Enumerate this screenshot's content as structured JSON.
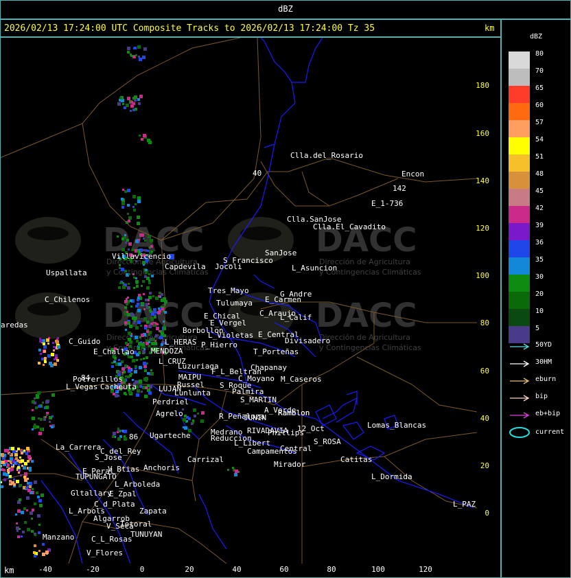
{
  "app": {
    "title": "dBZ"
  },
  "header": {
    "text": "2026/02/13 17:24:00 UTC Composite Tracks to 2026/02/13 17:24:00 Tz 35",
    "unit": "km"
  },
  "axes": {
    "bottom_unit": "km",
    "x_ticks": [
      "-40",
      "-20",
      "0",
      "20",
      "40",
      "60",
      "80",
      "100",
      "120"
    ],
    "y_ticks": [
      "180",
      "160",
      "140",
      "120",
      "100",
      "80",
      "60",
      "40",
      "20",
      "0"
    ]
  },
  "watermark": {
    "brand": "DACC",
    "line1": "Dirección de Agricultura",
    "line2": "y Contingencias Climáticas"
  },
  "places": [
    "Clla.del_Rosario",
    "Encon",
    "142",
    "E_1-736",
    "Ramblon",
    "Clla.SanJose",
    "Clla.El_Cavadito",
    "Villavicencio",
    "Capdevila",
    "Jocoli",
    "S_Francisco",
    "SanJose",
    "L_Asuncion",
    "Uspallata",
    "Tres_Mayo",
    "Tulumaya",
    "E_Carmen",
    "G_Andre",
    "C_Chilenos",
    "C_Araujo",
    "L_Calif",
    "aredas",
    "E_Chical",
    "E_Vergel",
    "Borbollon",
    "L_Violetas",
    "E_Central",
    "Divisadero",
    "C_Guido",
    "L_HERAS",
    "P_Hierro",
    "E_Challao",
    "MENDOZA",
    "T_Porteñas",
    "Chapanay",
    "L_CRUZ",
    "Luzuriaga",
    "F_L_Beltran",
    "Potrerillos",
    "MAIPU",
    "C_Moyano",
    "M_Caseros",
    "L_Vegas",
    "Cacheuta",
    "Russel",
    "S_Roque",
    "LUJAN",
    "Lunlunta",
    "Palmira",
    "Perdriel",
    "S_MARTIN",
    "A_Verde",
    "Agrelo",
    "R_Peñaloza",
    "JUNIN",
    "Ramblon",
    "Lomas_Blancas",
    "Ugarteche",
    "Medrano",
    "RIVADAVIA",
    "Phillips",
    "12_Oct",
    "Reduccion",
    "S_ROSA",
    "La_Carrera",
    "C_del_Rey",
    "L_Libert",
    "Central",
    "S_Jose",
    "Campamentos",
    "Catitas",
    "Carrizal",
    "E_Peral",
    "V_Btias",
    "Anchoris",
    "Mirador",
    "TUPUNGATO",
    "L_Dormida",
    "L_Arboleda",
    "Gltallary",
    "E_Zpal",
    "L_PAZ",
    "C_d_Plata",
    "L_Arbols",
    "Zapata",
    "Algarrob",
    "V_Seca",
    "Totoral",
    "TUNUYAN",
    "Manzano",
    "C_L_Rosas",
    "V_Flores",
    "84",
    "40",
    "86"
  ],
  "legend": {
    "title": "dBZ",
    "scale": [
      {
        "label": "80",
        "color": "#d9d9d9"
      },
      {
        "label": "70",
        "color": "#bdbdbd"
      },
      {
        "label": "65",
        "color": "#ff3b2a"
      },
      {
        "label": "60",
        "color": "#ff6a10"
      },
      {
        "label": "57",
        "color": "#ff9e5e"
      },
      {
        "label": "54",
        "color": "#ffff00"
      },
      {
        "label": "51",
        "color": "#f5c02a"
      },
      {
        "label": "48",
        "color": "#d6913a"
      },
      {
        "label": "45",
        "color": "#c77b84"
      },
      {
        "label": "42",
        "color": "#cc2a8a"
      },
      {
        "label": "39",
        "color": "#7a19c9"
      },
      {
        "label": "36",
        "color": "#1e46e8"
      },
      {
        "label": "35",
        "color": "#1388d9"
      },
      {
        "label": "30",
        "color": "#0d8a10"
      },
      {
        "label": "20",
        "color": "#0a6a0a"
      },
      {
        "label": "10",
        "color": "#0a4a10"
      },
      {
        "label": "5",
        "color": "#4a3a8a"
      }
    ],
    "tracks": [
      {
        "label": "50YD",
        "color": "#55e0e0"
      },
      {
        "label": "30HM",
        "color": "#ffffff"
      },
      {
        "label": "eburn",
        "color": "#e8c070"
      },
      {
        "label": "bip",
        "color": "#ffd8d0"
      },
      {
        "label": "eb+bip",
        "color": "#e040e0"
      },
      {
        "label": "current",
        "color": "#22e0e0"
      }
    ]
  }
}
